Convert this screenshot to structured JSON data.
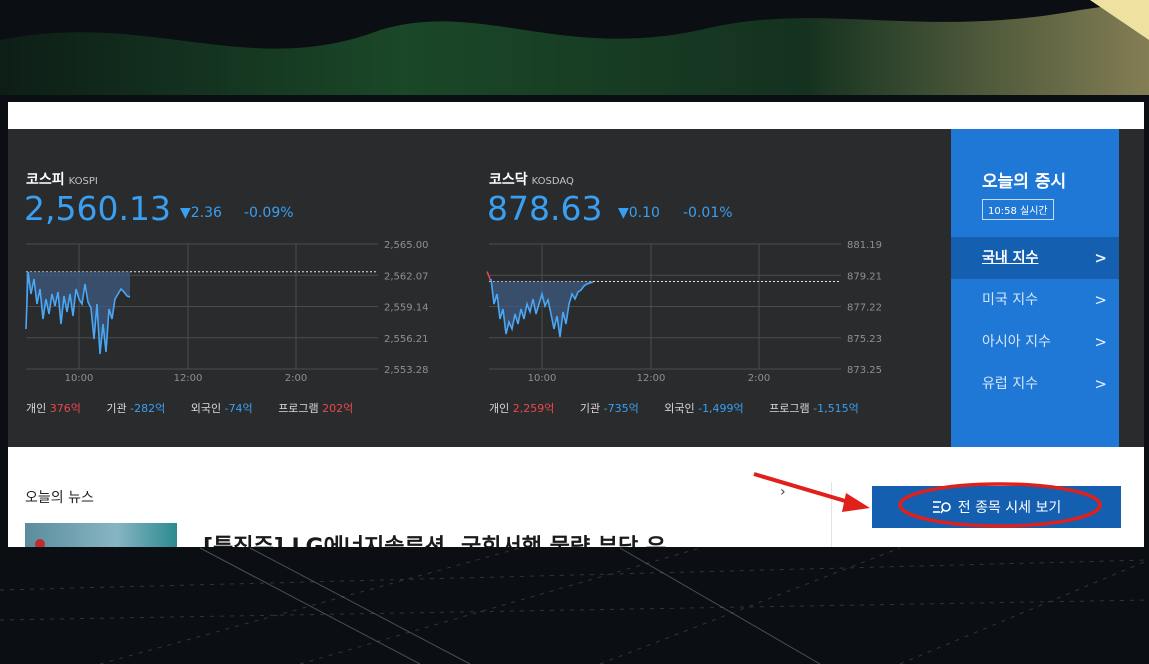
{
  "kospi": {
    "name": "코스피",
    "name_en": "KOSPI",
    "value": "2,560.13",
    "change": "▼2.36",
    "change_pct": "-0.09%",
    "y_ticks": [
      "2,565.00",
      "2,562.07",
      "2,559.14",
      "2,556.21",
      "2,553.28"
    ],
    "x_ticks": [
      "10:00",
      "12:00",
      "2:00"
    ],
    "investors": [
      {
        "label": "개인",
        "value": "376억",
        "sign": "pos"
      },
      {
        "label": "기관",
        "value": "-282억",
        "sign": "neg"
      },
      {
        "label": "외국인",
        "value": "-74억",
        "sign": "neg"
      },
      {
        "label": "프로그램",
        "value": "202억",
        "sign": "pos"
      }
    ]
  },
  "kosdaq": {
    "name": "코스닥",
    "name_en": "KOSDAQ",
    "value": "878.63",
    "change": "▼0.10",
    "change_pct": "-0.01%",
    "y_ticks": [
      "881.19",
      "879.21",
      "877.22",
      "875.23",
      "873.25"
    ],
    "x_ticks": [
      "10:00",
      "12:00",
      "2:00"
    ],
    "investors": [
      {
        "label": "개인",
        "value": "2,259억",
        "sign": "pos"
      },
      {
        "label": "기관",
        "value": "-735억",
        "sign": "neg"
      },
      {
        "label": "외국인",
        "value": "-1,499억",
        "sign": "neg"
      },
      {
        "label": "프로그램",
        "value": "-1,515억",
        "sign": "neg"
      }
    ]
  },
  "side": {
    "title": "오늘의 증시",
    "time": "10:58 실시간",
    "menu": [
      {
        "label": "국내 지수",
        "active": true
      },
      {
        "label": "미국 지수",
        "active": false
      },
      {
        "label": "아시아 지수",
        "active": false
      },
      {
        "label": "유럽 지수",
        "active": false
      }
    ]
  },
  "news": {
    "title": "오늘의 뉴스",
    "more": "›",
    "headline": "[특징주] LG에너지솔루션, 국회서행 물량 부담 우..."
  },
  "all_button": {
    "label": "전 종목 시세 보기",
    "icon": "list-search-icon"
  },
  "colors": {
    "accent": "#1f77d6",
    "down": "#3a9ff0",
    "up": "#e8484a",
    "annotation": "#e0201b"
  }
}
